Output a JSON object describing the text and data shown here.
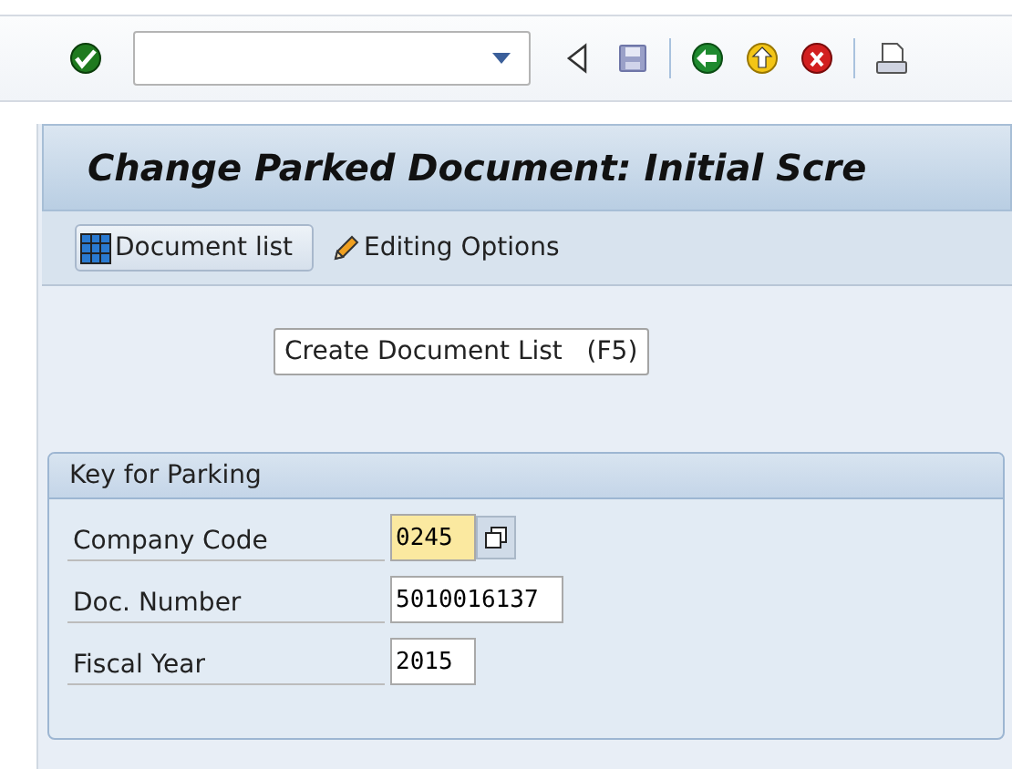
{
  "toolbar": {
    "buttons": [
      {
        "kind": "enter"
      },
      {
        "kind": "command"
      },
      {
        "kind": "collapse"
      },
      {
        "kind": "save"
      },
      {
        "kind": "sep"
      },
      {
        "kind": "back"
      },
      {
        "kind": "exit"
      },
      {
        "kind": "cancel"
      },
      {
        "kind": "sep"
      },
      {
        "kind": "print"
      }
    ]
  },
  "window": {
    "title": "Change Parked Document: Initial Scre"
  },
  "app_toolbar": [
    {
      "kind": "list",
      "label": "Document list",
      "framed": true
    },
    {
      "kind": "edit",
      "label": "Editing Options",
      "framed": false
    }
  ],
  "tooltip": "Create Document List   (F5)",
  "group": {
    "title": "Key for Parking",
    "fields": [
      {
        "label": "Company Code",
        "value": "0245",
        "focused": true,
        "help": true
      },
      {
        "label": "Doc. Number",
        "value": "5010016137",
        "focused": false,
        "help": false
      },
      {
        "label": "Fiscal Year",
        "value": "2015",
        "focused": false,
        "help": false
      }
    ]
  }
}
